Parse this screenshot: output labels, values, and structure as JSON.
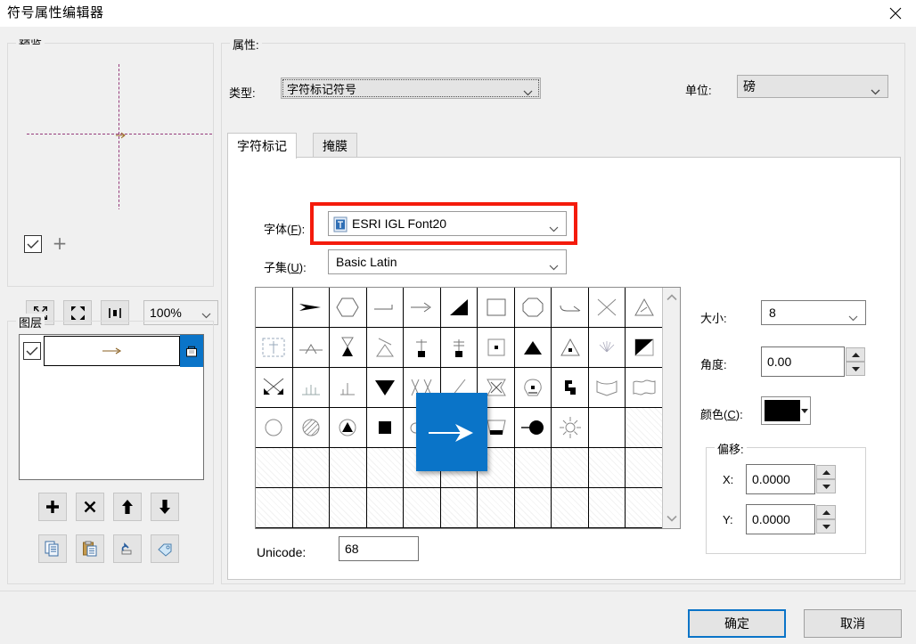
{
  "window": {
    "title": "符号属性编辑器",
    "close_icon": "close-icon"
  },
  "preview": {
    "group_label": "预览",
    "visible_checked": true,
    "add_icon": "plus-icon",
    "zoom_out_icon": "zoom-out-icon",
    "zoom_in_icon": "zoom-in-icon",
    "actual_size_icon": "actual-size-icon",
    "zoom_value": "100%"
  },
  "layers": {
    "group_label": "图层",
    "items": [
      {
        "checked": true,
        "symbol": "arrow-right-symbol",
        "locked": true
      }
    ],
    "buttons": [
      {
        "name": "add-layer-button",
        "icon": "plus-icon"
      },
      {
        "name": "delete-layer-button",
        "icon": "cross-icon"
      },
      {
        "name": "move-layer-up-button",
        "icon": "arrow-up-icon"
      },
      {
        "name": "move-layer-down-button",
        "icon": "arrow-down-icon"
      },
      {
        "name": "copy-layer-button",
        "icon": "copy-icon"
      },
      {
        "name": "paste-layer-button",
        "icon": "paste-icon"
      },
      {
        "name": "reset-layer-button",
        "icon": "undo-icon"
      },
      {
        "name": "tag-layer-button",
        "icon": "tag-icon"
      }
    ]
  },
  "properties": {
    "group_label": "属性:",
    "type_label": "类型:",
    "type_value": "字符标记符号",
    "unit_label": "单位:",
    "unit_value": "磅",
    "tabs": [
      {
        "label": "字符标记",
        "active": true
      },
      {
        "label": "掩膜",
        "active": false
      }
    ],
    "font_label_pre": "字体(",
    "font_label_key": "F",
    "font_label_post": "):",
    "font_value": "ESRI IGL Font20",
    "font_icon": "truetype-font-icon",
    "subset_label_pre": "子集(",
    "subset_label_key": "U",
    "subset_label_post": "):",
    "subset_value": "Basic Latin",
    "unicode_label": "Unicode:",
    "unicode_value": "68",
    "size_label": "大小:",
    "size_value": "8",
    "angle_label": "角度:",
    "angle_value": "0.00",
    "color_label_pre": "颜色(",
    "color_label_key": "C",
    "color_label_post": "):",
    "color_value": "#000000",
    "offset_group_label": "偏移:",
    "offset_x_label": "X:",
    "offset_x_value": "0.0000",
    "offset_y_label": "Y:",
    "offset_y_value": "0.0000",
    "highlight_color": "#f41b0c",
    "selection_color": "#0a74c8",
    "char_tooltip_symbol": "arrow-right-symbol"
  },
  "footer": {
    "ok_label": "确定",
    "cancel_label": "取消"
  }
}
